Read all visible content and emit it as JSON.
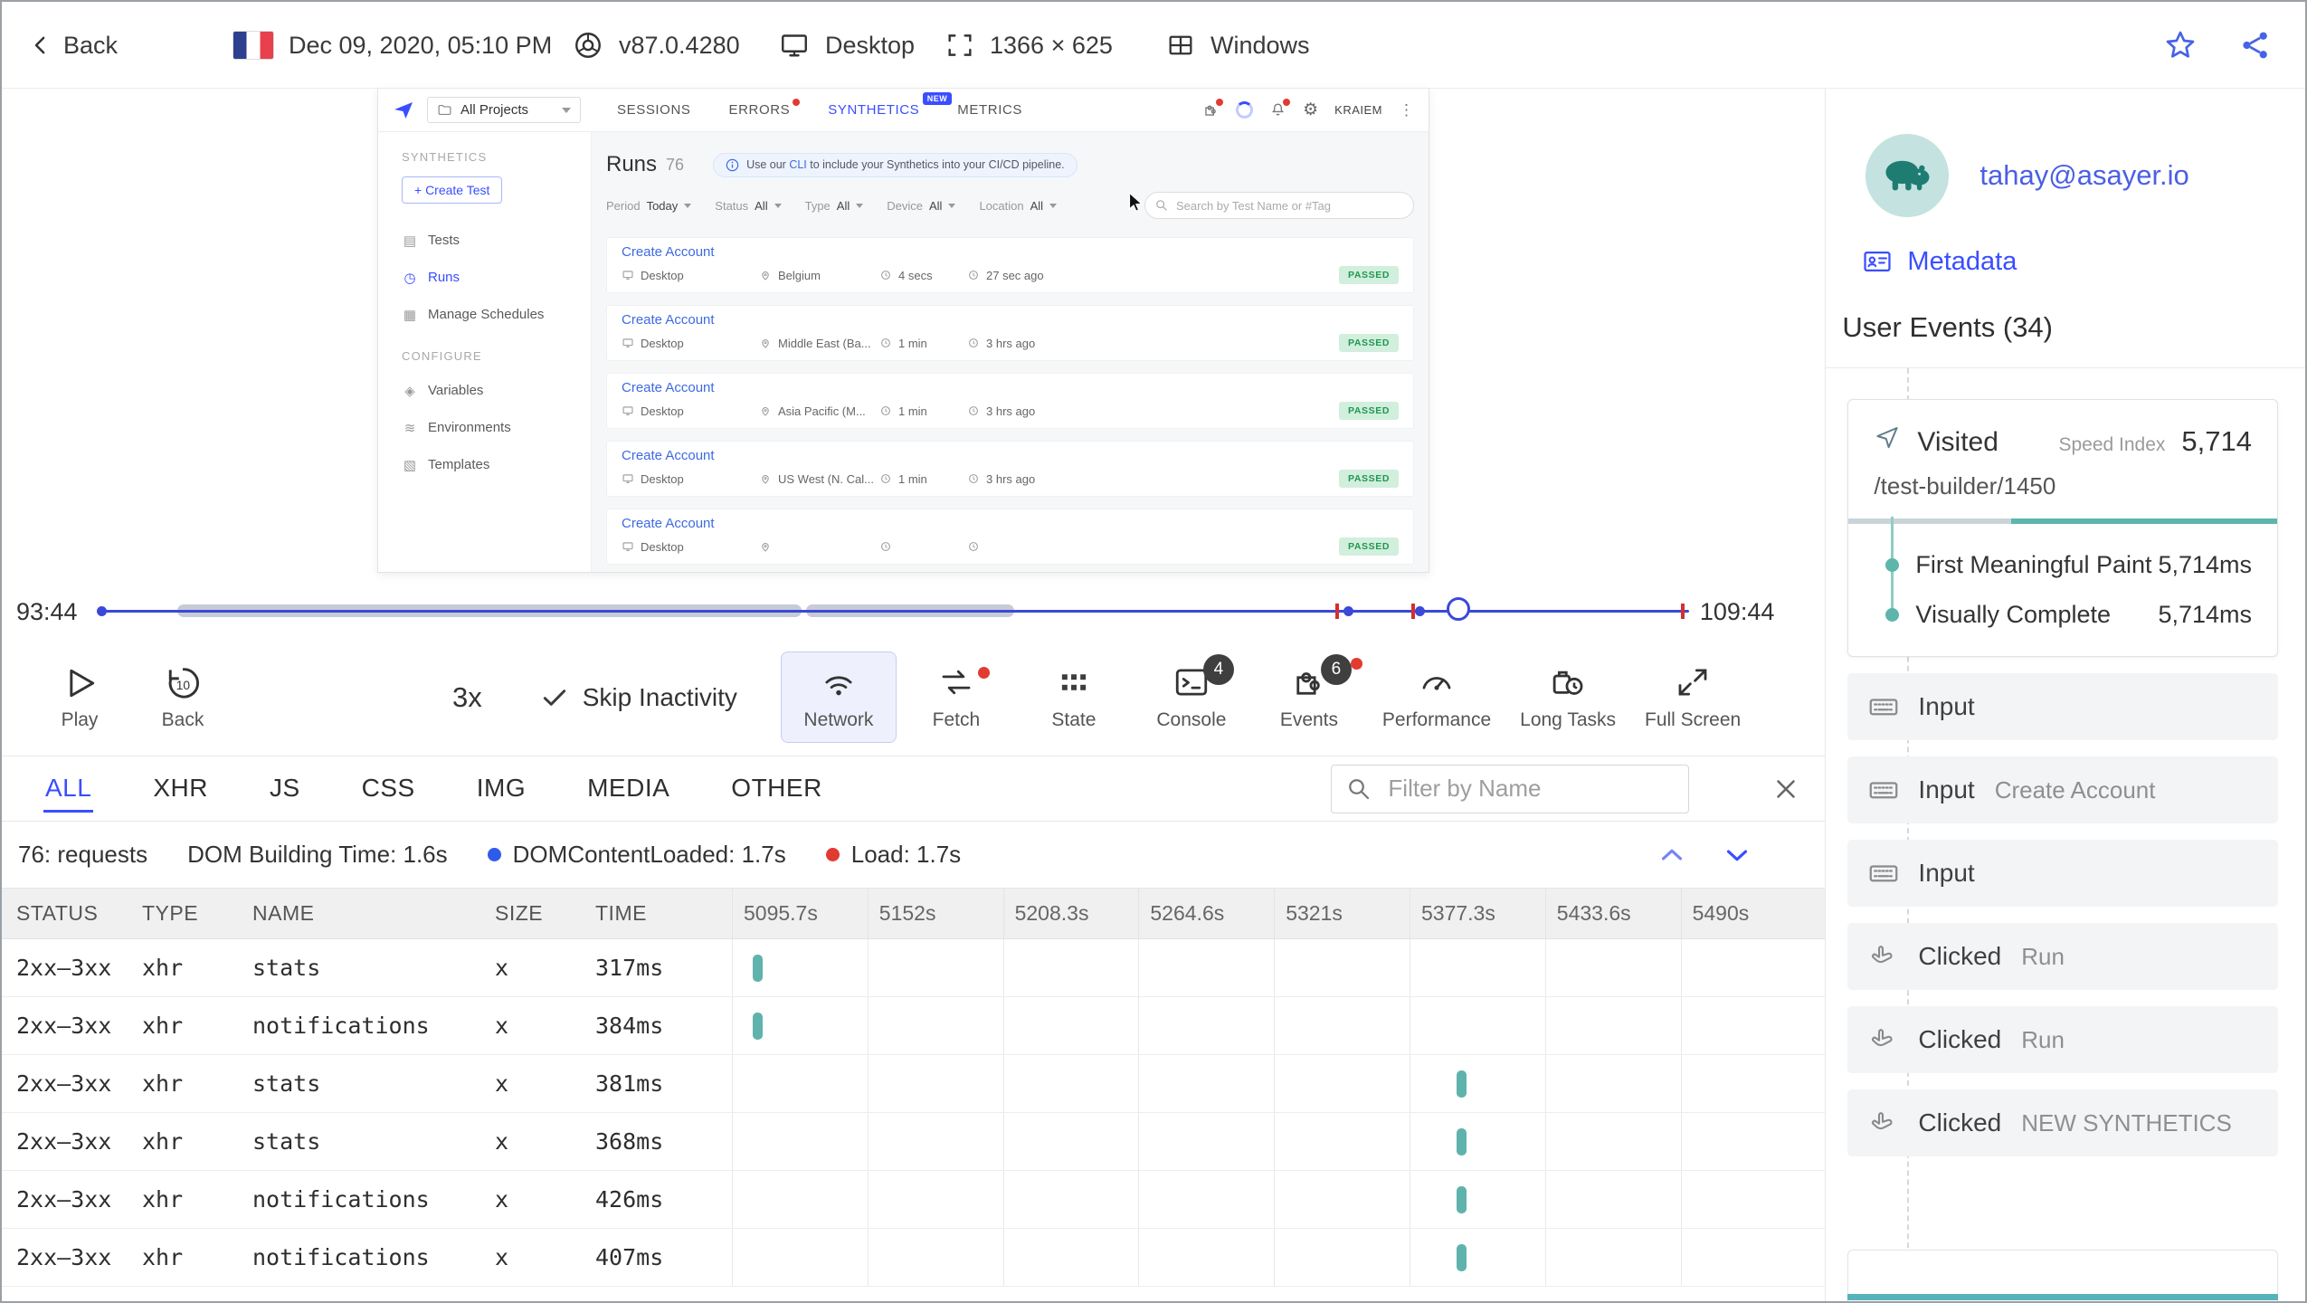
{
  "top_bar": {
    "back_label": "Back",
    "timestamp": "Dec 09, 2020, 05:10 PM",
    "browser_version": "v87.0.4280",
    "device_type": "Desktop",
    "resolution": "1366 × 625",
    "os": "Windows"
  },
  "replay": {
    "nav": {
      "project_selector": "All Projects",
      "tabs": [
        {
          "label": "SESSIONS",
          "state": ""
        },
        {
          "label": "ERRORS",
          "state": "has-dot"
        },
        {
          "label": "SYNTHETICS",
          "state": "active-tab"
        },
        {
          "label": "METRICS",
          "state": ""
        }
      ],
      "new_badge": "NEW",
      "user": "KRAIEM"
    },
    "sidebar": {
      "section_synthetics": "SYNTHETICS",
      "create_test": "+ Create Test",
      "items": [
        {
          "label": "Tests",
          "state": "",
          "glyph": "▤",
          "icon": "tests-icon"
        },
        {
          "label": "Runs",
          "state": "active",
          "glyph": "◷",
          "icon": "runs-icon"
        },
        {
          "label": "Manage Schedules",
          "state": "",
          "glyph": "▦",
          "icon": "schedules-icon"
        }
      ],
      "section_configure": "CONFIGURE",
      "config_items": [
        {
          "label": "Variables",
          "state": "",
          "glyph": "◈",
          "icon": "variables-icon"
        },
        {
          "label": "Environments",
          "state": "",
          "glyph": "≋",
          "icon": "environments-icon"
        },
        {
          "label": "Templates",
          "state": "",
          "glyph": "▧",
          "icon": "templates-icon"
        }
      ]
    },
    "main": {
      "title": "Runs",
      "count": "76",
      "banner": {
        "pre": "Use our ",
        "link": "CLI",
        "post": " to include your Synthetics into your CI/CD pipeline."
      },
      "filters": [
        {
          "label": "Period",
          "value": "Today"
        },
        {
          "label": "Status",
          "value": "All"
        },
        {
          "label": "Type",
          "value": "All"
        },
        {
          "label": "Device",
          "value": "All"
        },
        {
          "label": "Location",
          "value": "All"
        }
      ],
      "search_placeholder": "Search by Test Name or #Tag",
      "runs": [
        {
          "name": "Create Account",
          "device": "Desktop",
          "location": "Belgium",
          "duration": "4 secs",
          "ago": "27 sec ago",
          "status": "PASSED"
        },
        {
          "name": "Create Account",
          "device": "Desktop",
          "location": "Middle East (Ba...",
          "duration": "1 min",
          "ago": "3 hrs ago",
          "status": "PASSED"
        },
        {
          "name": "Create Account",
          "device": "Desktop",
          "location": "Asia Pacific (M...",
          "duration": "1 min",
          "ago": "3 hrs ago",
          "status": "PASSED"
        },
        {
          "name": "Create Account",
          "device": "Desktop",
          "location": "US West (N. Cal...",
          "duration": "1 min",
          "ago": "3 hrs ago",
          "status": "PASSED"
        },
        {
          "name": "Create Account",
          "device": "Desktop",
          "location": "",
          "duration": "",
          "ago": "",
          "status": "PASSED"
        }
      ]
    }
  },
  "timeline": {
    "current_time": "93:44",
    "end_time": "109:44",
    "knob_pos": 0.856,
    "activity": [
      {
        "s": 0.048,
        "w": 0.393
      },
      {
        "s": 0.444,
        "w": 0.131
      }
    ],
    "red_marks": [
      0.778,
      0.826,
      0.996
    ],
    "dots": [
      0,
      0.785,
      0.83
    ]
  },
  "controls": {
    "play_label": "Play",
    "back_label": "Back",
    "back_seconds": "10",
    "speed": "3x",
    "skip_label": "Skip Inactivity",
    "buttons": [
      {
        "label": "Network"
      },
      {
        "label": "Fetch"
      },
      {
        "label": "State"
      },
      {
        "label": "Console",
        "badge": "4"
      },
      {
        "label": "Events",
        "badge": "6"
      },
      {
        "label": "Performance"
      },
      {
        "label": "Long Tasks"
      },
      {
        "label": "Full Screen"
      }
    ]
  },
  "network_panel": {
    "tabs": [
      {
        "label": "ALL",
        "state": "active"
      },
      {
        "label": "XHR",
        "state": ""
      },
      {
        "label": "JS",
        "state": ""
      },
      {
        "label": "CSS",
        "state": ""
      },
      {
        "label": "IMG",
        "state": ""
      },
      {
        "label": "MEDIA",
        "state": ""
      },
      {
        "label": "OTHER",
        "state": ""
      }
    ],
    "filter_placeholder": "Filter by Name",
    "stats": {
      "requests": "76: requests",
      "dom_building": "DOM Building Time: 1.6s",
      "dom_content_loaded": "DOMContentLoaded: 1.7s",
      "load": "Load: 1.7s"
    },
    "columns": [
      "STATUS",
      "TYPE",
      "NAME",
      "SIZE",
      "TIME"
    ],
    "time_columns": [
      "5095.7s",
      "5152s",
      "5208.3s",
      "5264.6s",
      "5321s",
      "5377.3s",
      "5433.6s",
      "5490s"
    ],
    "rows": [
      {
        "status": "2xx–3xx",
        "type": "xhr",
        "name": "stats",
        "size": "x",
        "time": "317ms",
        "bar_pos": 0.019
      },
      {
        "status": "2xx–3xx",
        "type": "xhr",
        "name": "notifications",
        "size": "x",
        "time": "384ms",
        "bar_pos": 0.019
      },
      {
        "status": "2xx–3xx",
        "type": "xhr",
        "name": "stats",
        "size": "x",
        "time": "381ms",
        "bar_pos": 0.669
      },
      {
        "status": "2xx–3xx",
        "type": "xhr",
        "name": "stats",
        "size": "x",
        "time": "368ms",
        "bar_pos": 0.669
      },
      {
        "status": "2xx–3xx",
        "type": "xhr",
        "name": "notifications",
        "size": "x",
        "time": "426ms",
        "bar_pos": 0.669
      },
      {
        "status": "2xx–3xx",
        "type": "xhr",
        "name": "notifications",
        "size": "x",
        "time": "407ms",
        "bar_pos": 0.669
      }
    ]
  },
  "user_panel": {
    "email": "tahay@asayer.io",
    "metadata_label": "Metadata",
    "events_title": "User Events (34)",
    "visited": {
      "label": "Visited",
      "speed_index_label": "Speed Index",
      "speed_index_value": "5,714",
      "url": "/test-builder/1450",
      "metrics": [
        {
          "name": "First Meaningful Paint",
          "value": "5,714ms"
        },
        {
          "name": "Visually Complete",
          "value": "5,714ms"
        }
      ]
    },
    "events": [
      {
        "type": "input",
        "label": "Input",
        "detail": ""
      },
      {
        "type": "input",
        "label": "Input",
        "detail": "Create Account"
      },
      {
        "type": "input",
        "label": "Input",
        "detail": ""
      },
      {
        "type": "click",
        "label": "Clicked",
        "detail": "Run"
      },
      {
        "type": "click",
        "label": "Clicked",
        "detail": "Run"
      },
      {
        "type": "click",
        "label": "Clicked",
        "detail": "NEW SYNTHETICS"
      }
    ]
  }
}
